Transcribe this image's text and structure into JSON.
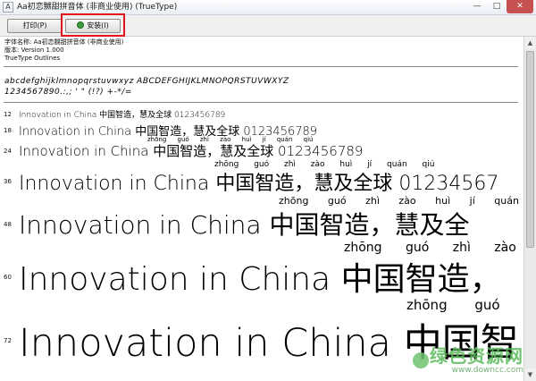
{
  "window": {
    "title": "Aa初恋嬲甜拼音体 (非商业使用) (TrueType)",
    "controls": {
      "minimize": "—",
      "maximize": "□",
      "close": "✕"
    }
  },
  "toolbar": {
    "print_label": "打印(P)",
    "install_label": "安装(I)"
  },
  "info": {
    "font_name": "字体名称: Aa初恋嬲甜拼音体 (非商业使用)",
    "version": "版本: Version 1.000",
    "type": "TrueType Outlines"
  },
  "charset": {
    "line1": "abcdefghijklmnopqrstuvwxyz ABCDEFGHIJKLMNOPQRSTUVWXYZ",
    "line2": "1234567890.:,; ' \" (!?) +-*/="
  },
  "samples": [
    {
      "size": "12",
      "text": "Innovation in China 中国智造，慧及全球 0123456789",
      "pinyin": ""
    },
    {
      "size": "18",
      "text": "Innovation in China 中国智造，慧及全球 0123456789",
      "pinyin": ""
    },
    {
      "size": "24",
      "text": "Innovation in China 中国智造，慧及全球 0123456789",
      "pinyin": "zhōng guó zhì zào huì jí quán qiú"
    },
    {
      "size": "36",
      "text": "Innovation in China 中国智造，慧及全球 01234567",
      "pinyin": "zhōng guó zhì zào huì jí quán qiú"
    },
    {
      "size": "48",
      "text": "Innovation in China 中国智造，慧及全",
      "pinyin": "zhōng guó zhì zào huì jí quán"
    },
    {
      "size": "60",
      "text": "Innovation in China 中国智造，",
      "pinyin": "zhōng guó zhì zào"
    },
    {
      "size": "72",
      "text": "Innovation in China 中国智",
      "pinyin": "zhōng guó"
    }
  ],
  "watermark": {
    "cn": "绿色资源网",
    "url": "www.downcc.com"
  }
}
